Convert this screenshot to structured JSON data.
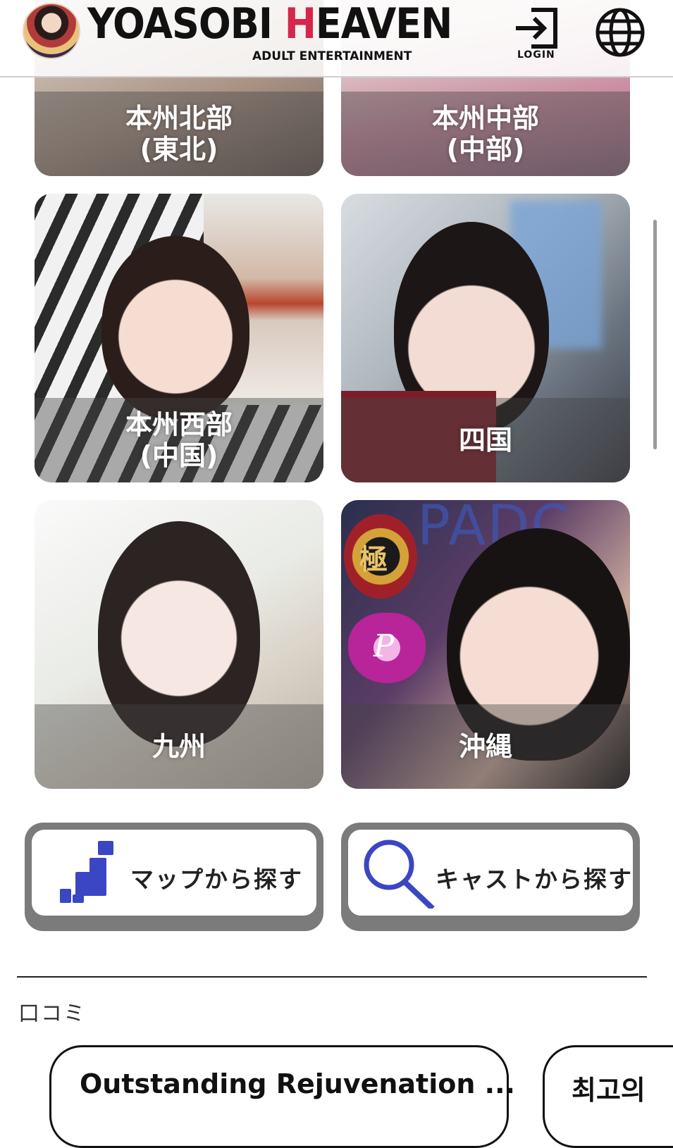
{
  "header": {
    "brand_main": "YOASOBI ",
    "brand_h": "H",
    "brand_rest": "EAVEN",
    "brand_sub": "ADULT ENTERTAINMENT",
    "login_label": "LOGIN",
    "icons": {
      "logo": "geisha-avatar-logo",
      "login": "login-icon",
      "globe": "globe-icon"
    },
    "accent_color": "#d6264b"
  },
  "regions": [
    {
      "line1": "本州北部",
      "line2": "(東北)"
    },
    {
      "line1": "本州中部",
      "line2": "(中部)"
    },
    {
      "line1": "本州西部",
      "line2": "(中国)"
    },
    {
      "line1": "四国",
      "line2": ""
    },
    {
      "line1": "九州",
      "line2": ""
    },
    {
      "line1": "沖縄",
      "line2": ""
    }
  ],
  "badges": {
    "kiwami": "極",
    "heart_letter": "P",
    "banner_text": "PADC"
  },
  "search": {
    "map": {
      "label": "マップから探す",
      "icon": "map-blocks-icon"
    },
    "cast": {
      "label": "キャストから探す",
      "icon": "magnifier-icon"
    },
    "icon_color": "#3b46c4"
  },
  "reviews": {
    "title": "口コミ",
    "cards": [
      {
        "title": "Outstanding Rejuvenation ..."
      },
      {
        "title": "최고의"
      }
    ]
  }
}
